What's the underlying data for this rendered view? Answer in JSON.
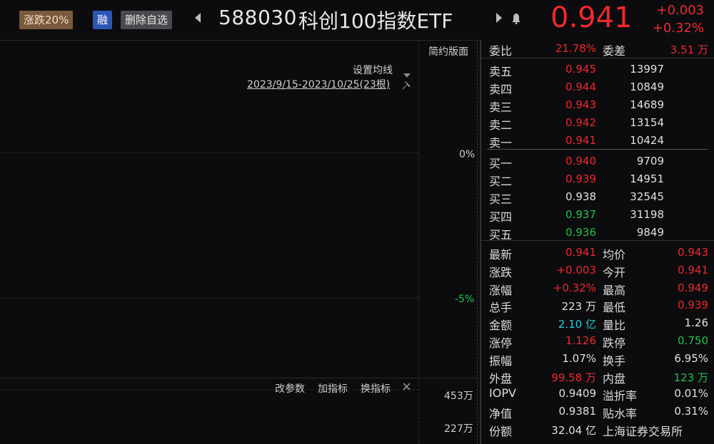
{
  "header": {
    "tag_limit": "涨跌20%",
    "tag_margin": "融",
    "remove_watchlist": "删除自选",
    "prev_icon": "triangle-left-icon",
    "next_icon": "triangle-right-icon",
    "bell_icon": "bell-icon",
    "code": "588030",
    "name": "科创100指数ETF",
    "price": "0.941",
    "change": "+0.003",
    "change_pct": "+0.32%"
  },
  "chart": {
    "simple_layout": "简约版面",
    "set_ma": "设置均线",
    "date_range": "2023/9/15-2023/10/25(23根)",
    "pct_zero": "0%",
    "pct_neg5": "-5%",
    "modify_params": "改参数",
    "add_indicator": "加指标",
    "change_indicator": "换指标",
    "close_icon": "×",
    "vol_high": "453万",
    "vol_mid": "227万"
  },
  "ratio": {
    "label1": "委比",
    "value1": "21.78%",
    "label2": "委差",
    "value2": "3.51 万"
  },
  "asks": [
    {
      "label": "卖五",
      "price": "0.945",
      "vol": "13997"
    },
    {
      "label": "卖四",
      "price": "0.944",
      "vol": "10849"
    },
    {
      "label": "卖三",
      "price": "0.943",
      "vol": "14689"
    },
    {
      "label": "卖二",
      "price": "0.942",
      "vol": "13154"
    },
    {
      "label": "卖一",
      "price": "0.941",
      "vol": "10424"
    }
  ],
  "bids": [
    {
      "label": "买一",
      "price": "0.940",
      "vol": "9709"
    },
    {
      "label": "买二",
      "price": "0.939",
      "vol": "14951"
    },
    {
      "label": "买三",
      "price": "0.938",
      "vol": "32545"
    },
    {
      "label": "买四",
      "price": "0.937",
      "vol": "31198"
    },
    {
      "label": "买五",
      "price": "0.936",
      "vol": "9849"
    }
  ],
  "stats": [
    {
      "l1": "最新",
      "v1": "0.941",
      "l2": "均价",
      "v2": "0.943"
    },
    {
      "l1": "涨跌",
      "v1": "+0.003",
      "l2": "今开",
      "v2": "0.941"
    },
    {
      "l1": "涨幅",
      "v1": "+0.32%",
      "l2": "最高",
      "v2": "0.949"
    },
    {
      "l1": "总手",
      "v1": "223 万",
      "l2": "最低",
      "v2": "0.939"
    },
    {
      "l1": "金额",
      "v1": "2.10 亿",
      "l2": "量比",
      "v2": "1.26"
    },
    {
      "l1": "涨停",
      "v1": "1.126",
      "l2": "跌停",
      "v2": "0.750"
    },
    {
      "l1": "振幅",
      "v1": "1.07%",
      "l2": "换手",
      "v2": "6.95%"
    },
    {
      "l1": "外盘",
      "v1": "99.58 万",
      "l2": "内盘",
      "v2": "123 万"
    },
    {
      "l1": "IOPV",
      "v1": "0.9409",
      "l2": "溢折率",
      "v2": "0.01%"
    },
    {
      "l1": "净值",
      "v1": "0.9381",
      "l2": "贴水率",
      "v2": "0.31%"
    },
    {
      "l1": "份额",
      "v1": "32.04 亿",
      "l2": "上海证券交易所",
      "v2": ""
    }
  ],
  "colors": {
    "up": "#f0282d",
    "down": "#20c24a",
    "flat": "#e0e0e0",
    "amount": "#23c8d8"
  }
}
